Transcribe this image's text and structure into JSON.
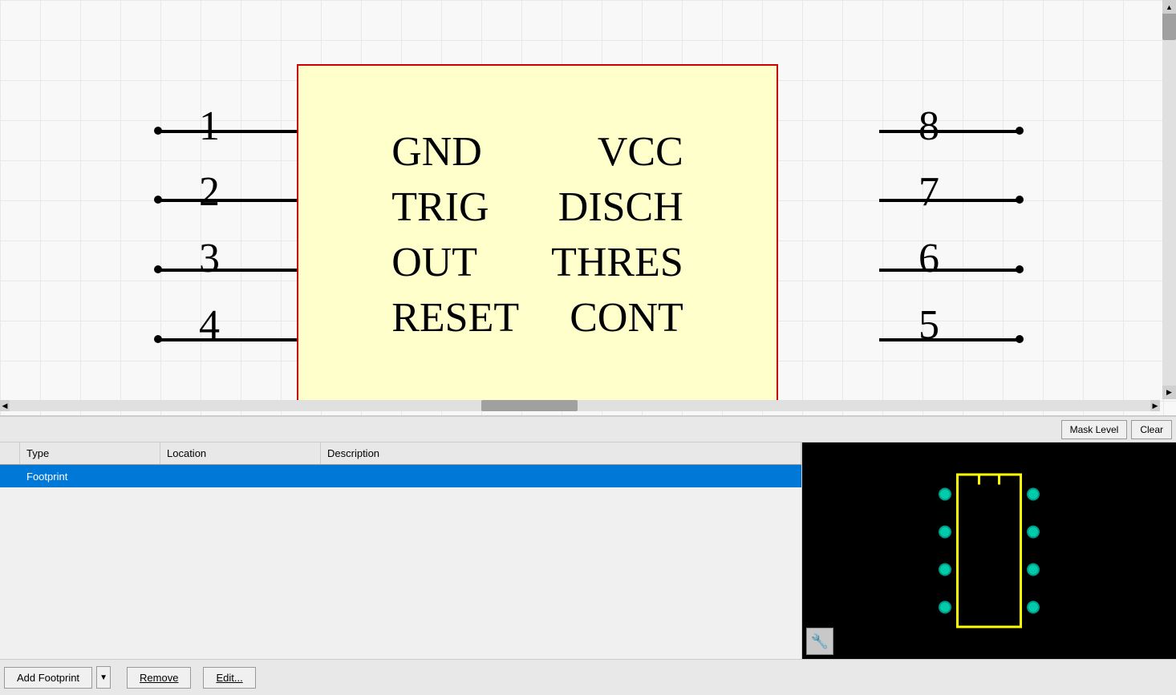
{
  "schematic": {
    "ic": {
      "pins_left": [
        {
          "number": "1",
          "label": "GND"
        },
        {
          "number": "2",
          "label": "TRIG"
        },
        {
          "number": "3",
          "label": "OUT"
        },
        {
          "number": "4",
          "label": "RESET"
        }
      ],
      "pins_right": [
        {
          "number": "8",
          "label": "VCC"
        },
        {
          "number": "7",
          "label": "DISCH"
        },
        {
          "number": "6",
          "label": "THRES"
        },
        {
          "number": "5",
          "label": "CONT"
        }
      ]
    }
  },
  "toolbar": {
    "mask_level_label": "Mask Level",
    "clear_label": "Clear"
  },
  "table": {
    "columns": [
      {
        "id": "check",
        "label": ""
      },
      {
        "id": "type",
        "label": "Type"
      },
      {
        "id": "location",
        "label": "Location"
      },
      {
        "id": "description",
        "label": "Description"
      }
    ],
    "rows": [
      {
        "check": "",
        "type": "Footprint",
        "location": "",
        "description": ""
      }
    ]
  },
  "buttons": {
    "add_footprint": "Add Footprint",
    "remove": "Remove",
    "edit": "Edit..."
  },
  "preview": {
    "pins_left": [
      0,
      1,
      2,
      3
    ],
    "pins_right": [
      0,
      1,
      2,
      3
    ]
  }
}
